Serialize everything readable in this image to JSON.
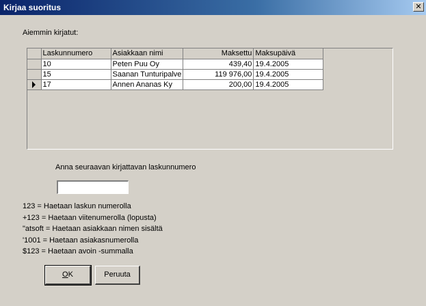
{
  "window": {
    "title": "Kirjaa suoritus",
    "close_glyph": "✕"
  },
  "previous_label": "Aiemmin kirjatut:",
  "grid": {
    "columns": [
      "Laskunnumero",
      "Asiakkaan nimi",
      "Maksettu",
      "Maksupäivä"
    ],
    "rows": [
      {
        "number": "10",
        "customer": "Peten Puu Oy",
        "paid": "439,40",
        "date": "19.4.2005",
        "current": false
      },
      {
        "number": "15",
        "customer": "Saanan Tunturipalve",
        "paid": "119 976,00",
        "date": "19.4.2005",
        "current": false
      },
      {
        "number": "17",
        "customer": "Annen Ananas Ky",
        "paid": "200,00",
        "date": "19.4.2005",
        "current": true
      }
    ]
  },
  "prompt_label": "Anna seuraavan kirjattavan laskunnumero",
  "invoice_input": {
    "value": "",
    "placeholder": ""
  },
  "help_lines": [
    "123  = Haetaan laskun numerolla",
    "+123 = Haetaan viitenumerolla (lopusta)",
    "\"atsoft = Haetaan asiakkaan nimen sisältä",
    "'1001 = Haetaan asiakasnumerolla",
    "$123 = Haetaan avoin -summalla"
  ],
  "buttons": {
    "ok_mnemonic": "O",
    "ok_rest": "K",
    "cancel": "Peruuta"
  },
  "icons": {
    "row_pointer": "arrow-right-icon"
  }
}
